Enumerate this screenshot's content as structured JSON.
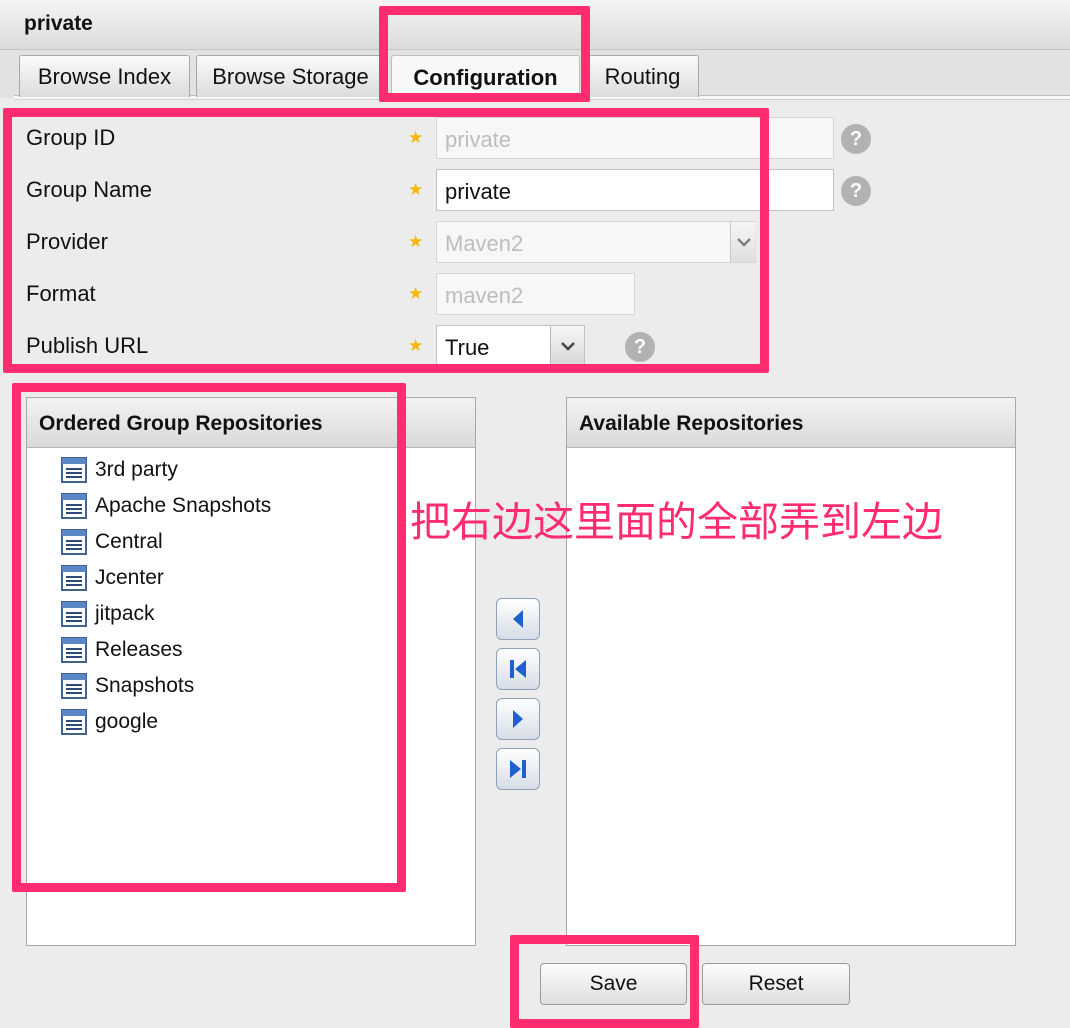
{
  "window": {
    "title": "private"
  },
  "tabs": [
    {
      "label": "Browse Index"
    },
    {
      "label": "Browse Storage"
    },
    {
      "label": "Configuration",
      "active": true
    },
    {
      "label": "Routing"
    }
  ],
  "form": {
    "group_id": {
      "label": "Group ID",
      "value": "private",
      "disabled": true
    },
    "group_name": {
      "label": "Group Name",
      "value": "private"
    },
    "provider": {
      "label": "Provider",
      "value": "Maven2",
      "disabled": true
    },
    "format": {
      "label": "Format",
      "value": "maven2",
      "disabled": true
    },
    "publish_url": {
      "label": "Publish URL",
      "value": "True"
    },
    "help_glyph": "?",
    "required_glyph": "★"
  },
  "ordered_panel": {
    "title": "Ordered Group Repositories",
    "items": [
      "3rd party",
      "Apache Snapshots",
      "Central",
      "Jcenter",
      "jitpack",
      "Releases",
      "Snapshots",
      "google"
    ]
  },
  "available_panel": {
    "title": "Available Repositories",
    "items": []
  },
  "buttons": {
    "save": "Save",
    "reset": "Reset"
  },
  "annotation": {
    "text": "把右边这里面的全部弄到左边",
    "color": "#ff2d6f"
  },
  "colors": {
    "highlight": "#ff2d6f",
    "star": "#f5b800",
    "arrow": "#1f5fd0"
  },
  "icons": {
    "required": "star-icon",
    "help": "help-icon",
    "dropdown": "chevron-down-icon",
    "repository": "repository-icon",
    "move_left": "arrow-left-icon",
    "move_all_left": "arrow-first-icon",
    "move_right": "arrow-right-icon",
    "move_all_right": "arrow-last-icon"
  }
}
